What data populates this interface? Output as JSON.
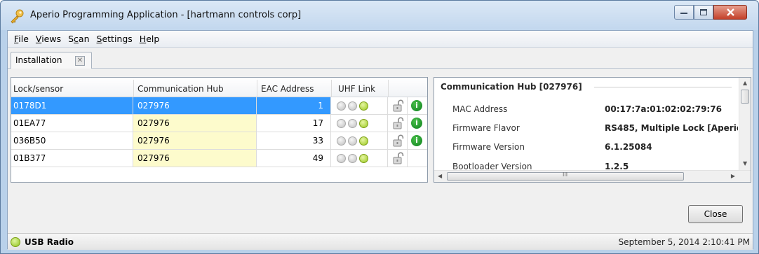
{
  "window": {
    "title": "Aperio Programming Application - [hartmann controls corp]"
  },
  "menu": [
    {
      "label": "File",
      "mnemonic": "F",
      "rest": "ile"
    },
    {
      "label": "Views",
      "mnemonic": "V",
      "rest": "iews"
    },
    {
      "label": "Scan",
      "mnemonic_prefix": "S",
      "mnemonic": "c",
      "rest": "an"
    },
    {
      "label": "Settings",
      "mnemonic": "S",
      "rest": "ettings"
    },
    {
      "label": "Help",
      "mnemonic": "H",
      "rest": "elp"
    }
  ],
  "tab": {
    "label": "Installation"
  },
  "grid": {
    "columns": [
      "Lock/sensor",
      "Communication Hub",
      "EAC Address",
      "UHF Link"
    ],
    "rows": [
      {
        "lock": "0178D1",
        "hub": "027976",
        "eac": "1",
        "uhf": [
          "grey",
          "grey",
          "green"
        ],
        "info": true,
        "selected": true
      },
      {
        "lock": "01EA77",
        "hub": "027976",
        "eac": "17",
        "uhf": [
          "grey",
          "grey",
          "green"
        ],
        "info": true,
        "selected": false
      },
      {
        "lock": "036B50",
        "hub": "027976",
        "eac": "33",
        "uhf": [
          "grey",
          "grey",
          "green"
        ],
        "info": true,
        "selected": false
      },
      {
        "lock": "01B377",
        "hub": "027976",
        "eac": "49",
        "uhf": [
          "grey",
          "grey",
          "green"
        ],
        "info": false,
        "selected": false
      }
    ]
  },
  "details": {
    "title": "Communication Hub [027976]",
    "fields": [
      {
        "label": "MAC Address",
        "value": "00:17:7a:01:02:02:79:76"
      },
      {
        "label": "Firmware Flavor",
        "value": "RS485, Multiple Lock [Aperio"
      },
      {
        "label": "Firmware Version",
        "value": "6.1.25084"
      },
      {
        "label": "Bootloader Version",
        "value": "1.2.5"
      }
    ],
    "hscroll_grip": "III"
  },
  "buttons": {
    "close": "Close"
  },
  "status": {
    "left": "USB Radio",
    "right": "September 5, 2014 2:10:41 PM"
  },
  "colors": {
    "selection": "#3399ff",
    "hub_cell": "#fdfbcc",
    "link_ok": "#9ac91f",
    "info": "#0b7f1c"
  }
}
